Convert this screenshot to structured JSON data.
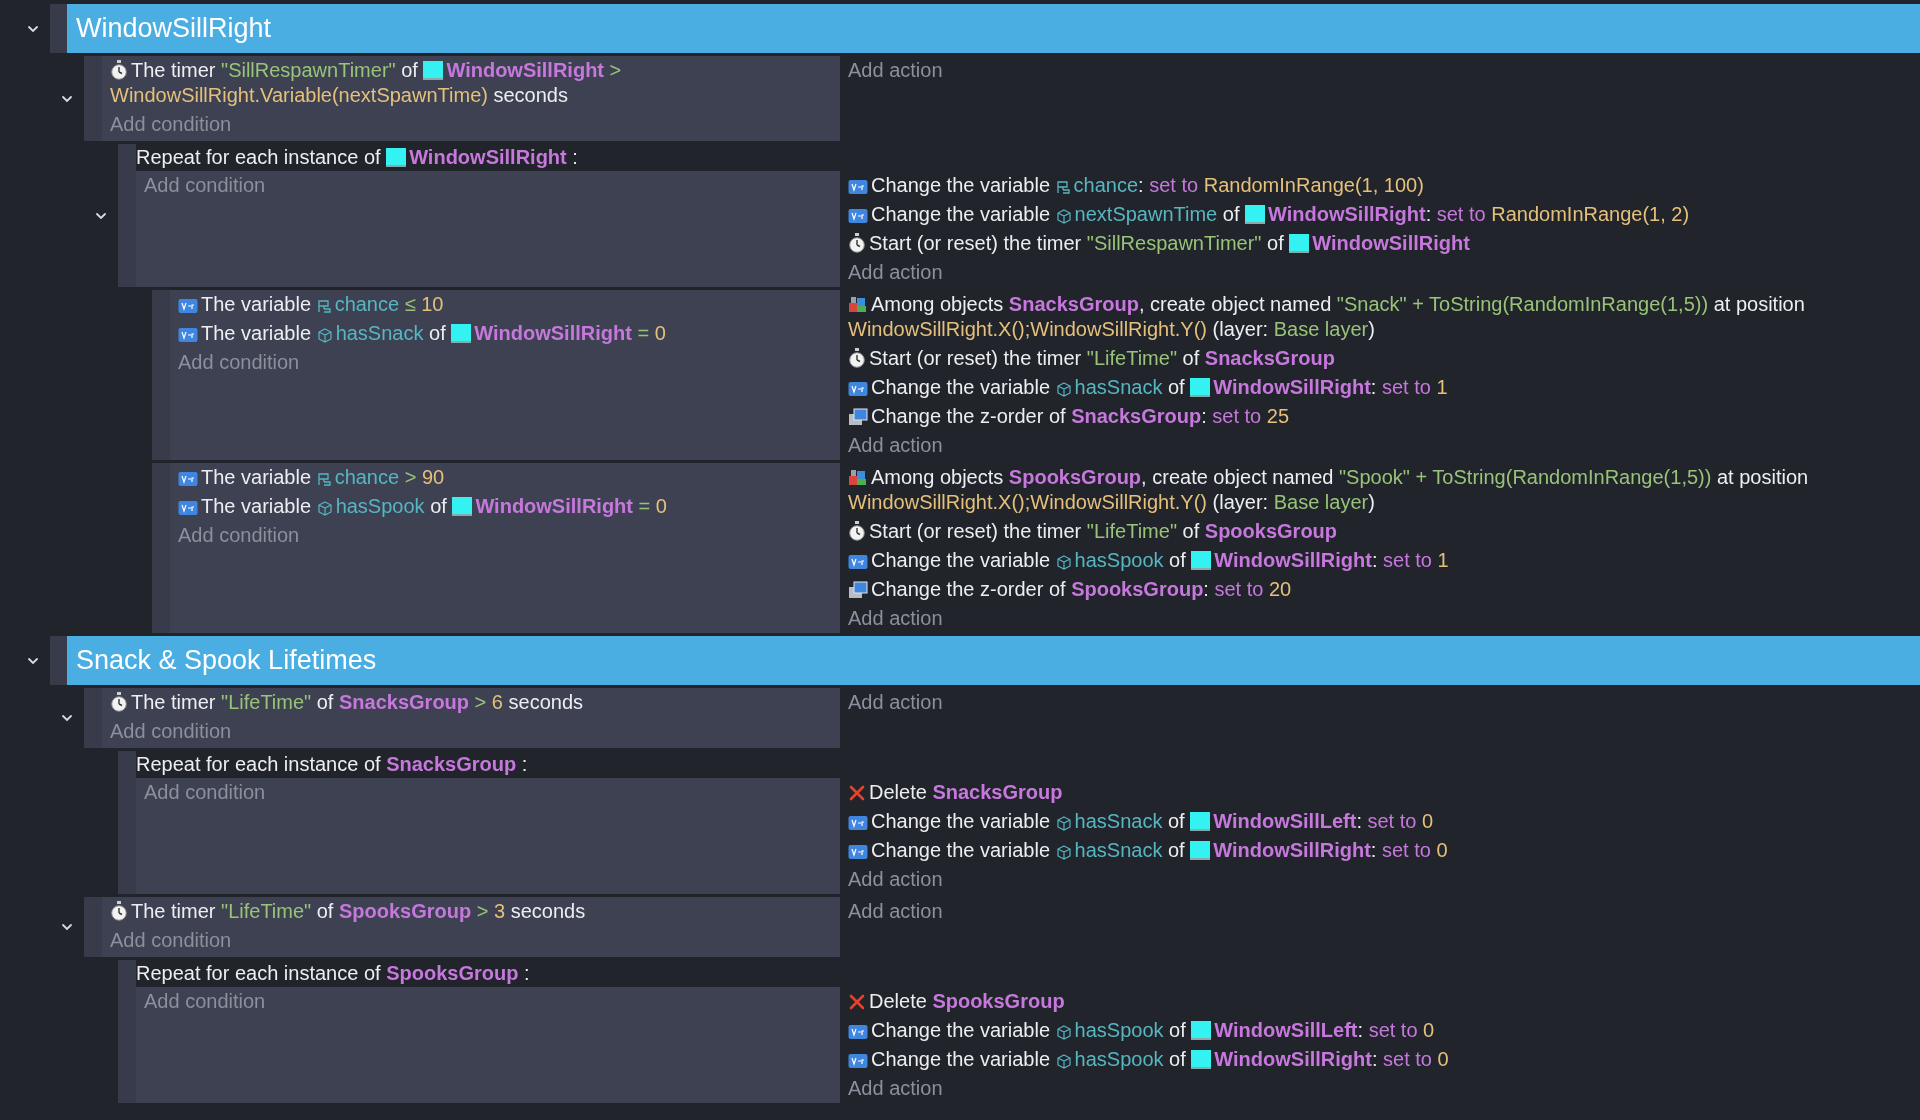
{
  "groups": [
    {
      "title": "WindowSillRight",
      "expanded": true,
      "events": [
        {
          "kind": "standard",
          "expanded": true,
          "conditions": [
            {
              "kind": "timer",
              "segments": [
                {
                  "kind": "text",
                  "text": "The timer"
                },
                {
                  "kind": "string",
                  "text": "\"SillRespawnTimer\""
                },
                {
                  "kind": "text",
                  "text": "of"
                },
                {
                  "kind": "object",
                  "text": "WindowSillRight",
                  "swatch": true
                },
                {
                  "kind": "op",
                  "text": ">"
                },
                {
                  "kind": "expr",
                  "text": "WindowSillRight.Variable(nextSpawnTime)"
                },
                {
                  "kind": "text",
                  "text": "seconds"
                }
              ]
            }
          ],
          "add_condition": "Add condition",
          "add_action": "Add action",
          "children": [
            {
              "kind": "foreach",
              "expanded": true,
              "header": [
                {
                  "kind": "text",
                  "text": "Repeat for each instance of"
                },
                {
                  "kind": "object",
                  "text": "WindowSillRight",
                  "swatch": true
                },
                {
                  "kind": "text",
                  "text": ":"
                }
              ],
              "add_condition": "Add condition",
              "actions": [
                {
                  "kind": "variable",
                  "segments": [
                    {
                      "kind": "text",
                      "text": "Change the variable"
                    },
                    {
                      "kind": "scenevar",
                      "text": "chance"
                    },
                    {
                      "kind": "punct",
                      "text": ":"
                    },
                    {
                      "kind": "keyword",
                      "text": "set to"
                    },
                    {
                      "kind": "expr",
                      "text": "RandomInRange(1, 100)"
                    }
                  ]
                },
                {
                  "kind": "variable",
                  "segments": [
                    {
                      "kind": "text",
                      "text": "Change the variable"
                    },
                    {
                      "kind": "objectvar",
                      "text": "nextSpawnTime"
                    },
                    {
                      "kind": "text",
                      "text": "of"
                    },
                    {
                      "kind": "object",
                      "text": "WindowSillRight",
                      "swatch": true
                    },
                    {
                      "kind": "punct",
                      "text": ":"
                    },
                    {
                      "kind": "keyword",
                      "text": "set to"
                    },
                    {
                      "kind": "expr",
                      "text": "RandomInRange(1, 2)"
                    }
                  ]
                },
                {
                  "kind": "timer",
                  "segments": [
                    {
                      "kind": "text",
                      "text": "Start (or reset) the timer"
                    },
                    {
                      "kind": "string",
                      "text": "\"SillRespawnTimer\""
                    },
                    {
                      "kind": "text",
                      "text": "of"
                    },
                    {
                      "kind": "object",
                      "text": "WindowSillRight",
                      "swatch": true
                    }
                  ]
                }
              ],
              "add_action": "Add action",
              "children": [
                {
                  "kind": "standard",
                  "conditions": [
                    {
                      "kind": "variable",
                      "segments": [
                        {
                          "kind": "text",
                          "text": "The variable"
                        },
                        {
                          "kind": "scenevar",
                          "text": "chance"
                        },
                        {
                          "kind": "op",
                          "text": "≤"
                        },
                        {
                          "kind": "expr",
                          "text": "10"
                        }
                      ]
                    },
                    {
                      "kind": "variable",
                      "segments": [
                        {
                          "kind": "text",
                          "text": "The variable"
                        },
                        {
                          "kind": "objectvar",
                          "text": "hasSnack"
                        },
                        {
                          "kind": "text",
                          "text": "of"
                        },
                        {
                          "kind": "object",
                          "text": "WindowSillRight",
                          "swatch": true
                        },
                        {
                          "kind": "op",
                          "text": "="
                        },
                        {
                          "kind": "expr",
                          "text": "0"
                        }
                      ]
                    }
                  ],
                  "add_condition": "Add condition",
                  "actions": [
                    {
                      "kind": "create",
                      "segments": [
                        {
                          "kind": "text",
                          "text": "Among objects"
                        },
                        {
                          "kind": "object",
                          "text": "SnacksGroup",
                          "swatch": false
                        },
                        {
                          "kind": "punct",
                          "text": ","
                        },
                        {
                          "kind": "text",
                          "text": "create object named"
                        },
                        {
                          "kind": "string",
                          "text": "\"Snack\" + ToString(RandomInRange(1,5))"
                        },
                        {
                          "kind": "text",
                          "text": "at"
                        },
                        {
                          "kind": "text",
                          "text": "position"
                        },
                        {
                          "kind": "expr",
                          "text": "WindowSillRight.X();WindowSillRight.Y()"
                        },
                        {
                          "kind": "text",
                          "text": "(layer:"
                        },
                        {
                          "kind": "string",
                          "text": "Base layer"
                        },
                        {
                          "kind": "punct",
                          "text": ")"
                        }
                      ]
                    },
                    {
                      "kind": "timer",
                      "segments": [
                        {
                          "kind": "text",
                          "text": "Start (or reset) the timer"
                        },
                        {
                          "kind": "string",
                          "text": "\"LifeTime\""
                        },
                        {
                          "kind": "text",
                          "text": "of"
                        },
                        {
                          "kind": "object",
                          "text": "SnacksGroup",
                          "swatch": false
                        }
                      ]
                    },
                    {
                      "kind": "variable",
                      "segments": [
                        {
                          "kind": "text",
                          "text": "Change the variable"
                        },
                        {
                          "kind": "objectvar",
                          "text": "hasSnack"
                        },
                        {
                          "kind": "text",
                          "text": "of"
                        },
                        {
                          "kind": "object",
                          "text": "WindowSillRight",
                          "swatch": true
                        },
                        {
                          "kind": "punct",
                          "text": ":"
                        },
                        {
                          "kind": "keyword",
                          "text": "set to"
                        },
                        {
                          "kind": "expr",
                          "text": "1"
                        }
                      ]
                    },
                    {
                      "kind": "zorder",
                      "segments": [
                        {
                          "kind": "text",
                          "text": "Change the z-order of"
                        },
                        {
                          "kind": "object",
                          "text": "SnacksGroup",
                          "swatch": false
                        },
                        {
                          "kind": "punct",
                          "text": ":"
                        },
                        {
                          "kind": "keyword",
                          "text": "set to"
                        },
                        {
                          "kind": "expr",
                          "text": "25"
                        }
                      ]
                    }
                  ],
                  "add_action": "Add action"
                },
                {
                  "kind": "standard",
                  "conditions": [
                    {
                      "kind": "variable",
                      "segments": [
                        {
                          "kind": "text",
                          "text": "The variable"
                        },
                        {
                          "kind": "scenevar",
                          "text": "chance"
                        },
                        {
                          "kind": "op",
                          "text": ">"
                        },
                        {
                          "kind": "expr",
                          "text": "90"
                        }
                      ]
                    },
                    {
                      "kind": "variable",
                      "segments": [
                        {
                          "kind": "text",
                          "text": "The variable"
                        },
                        {
                          "kind": "objectvar",
                          "text": "hasSpook"
                        },
                        {
                          "kind": "text",
                          "text": "of"
                        },
                        {
                          "kind": "object",
                          "text": "WindowSillRight",
                          "swatch": true
                        },
                        {
                          "kind": "op",
                          "text": "="
                        },
                        {
                          "kind": "expr",
                          "text": "0"
                        }
                      ]
                    }
                  ],
                  "add_condition": "Add condition",
                  "actions": [
                    {
                      "kind": "create",
                      "segments": [
                        {
                          "kind": "text",
                          "text": "Among objects"
                        },
                        {
                          "kind": "object",
                          "text": "SpooksGroup",
                          "swatch": false
                        },
                        {
                          "kind": "punct",
                          "text": ","
                        },
                        {
                          "kind": "text",
                          "text": "create object named"
                        },
                        {
                          "kind": "string",
                          "text": "\"Spook\" + ToString(RandomInRange(1,5))"
                        },
                        {
                          "kind": "text",
                          "text": "at"
                        },
                        {
                          "kind": "text",
                          "text": "position"
                        },
                        {
                          "kind": "expr",
                          "text": "WindowSillRight.X();WindowSillRight.Y()"
                        },
                        {
                          "kind": "text",
                          "text": "(layer:"
                        },
                        {
                          "kind": "string",
                          "text": "Base layer"
                        },
                        {
                          "kind": "punct",
                          "text": ")"
                        }
                      ]
                    },
                    {
                      "kind": "timer",
                      "segments": [
                        {
                          "kind": "text",
                          "text": "Start (or reset) the timer"
                        },
                        {
                          "kind": "string",
                          "text": "\"LifeTime\""
                        },
                        {
                          "kind": "text",
                          "text": "of"
                        },
                        {
                          "kind": "object",
                          "text": "SpooksGroup",
                          "swatch": false
                        }
                      ]
                    },
                    {
                      "kind": "variable",
                      "segments": [
                        {
                          "kind": "text",
                          "text": "Change the variable"
                        },
                        {
                          "kind": "objectvar",
                          "text": "hasSpook"
                        },
                        {
                          "kind": "text",
                          "text": "of"
                        },
                        {
                          "kind": "object",
                          "text": "WindowSillRight",
                          "swatch": true
                        },
                        {
                          "kind": "punct",
                          "text": ":"
                        },
                        {
                          "kind": "keyword",
                          "text": "set to"
                        },
                        {
                          "kind": "expr",
                          "text": "1"
                        }
                      ]
                    },
                    {
                      "kind": "zorder",
                      "segments": [
                        {
                          "kind": "text",
                          "text": "Change the z-order of"
                        },
                        {
                          "kind": "object",
                          "text": "SpooksGroup",
                          "swatch": false
                        },
                        {
                          "kind": "punct",
                          "text": ":"
                        },
                        {
                          "kind": "keyword",
                          "text": "set to"
                        },
                        {
                          "kind": "expr",
                          "text": "20"
                        }
                      ]
                    }
                  ],
                  "add_action": "Add action"
                }
              ]
            }
          ]
        }
      ]
    },
    {
      "title": "Snack & Spook Lifetimes",
      "expanded": true,
      "events": [
        {
          "kind": "standard",
          "expanded": true,
          "conditions": [
            {
              "kind": "timer",
              "segments": [
                {
                  "kind": "text",
                  "text": "The timer"
                },
                {
                  "kind": "string",
                  "text": "\"LifeTime\""
                },
                {
                  "kind": "text",
                  "text": "of"
                },
                {
                  "kind": "object",
                  "text": "SnacksGroup",
                  "swatch": false
                },
                {
                  "kind": "op",
                  "text": ">"
                },
                {
                  "kind": "expr",
                  "text": "6"
                },
                {
                  "kind": "text",
                  "text": "seconds"
                }
              ]
            }
          ],
          "add_condition": "Add condition",
          "add_action": "Add action",
          "children": [
            {
              "kind": "foreach",
              "header": [
                {
                  "kind": "text",
                  "text": "Repeat for each instance of"
                },
                {
                  "kind": "object",
                  "text": "SnacksGroup",
                  "swatch": false
                },
                {
                  "kind": "text",
                  "text": ":"
                }
              ],
              "add_condition": "Add condition",
              "actions": [
                {
                  "kind": "delete",
                  "segments": [
                    {
                      "kind": "text",
                      "text": "Delete"
                    },
                    {
                      "kind": "object",
                      "text": "SnacksGroup",
                      "swatch": false
                    }
                  ]
                },
                {
                  "kind": "variable",
                  "segments": [
                    {
                      "kind": "text",
                      "text": "Change the variable"
                    },
                    {
                      "kind": "objectvar",
                      "text": "hasSnack"
                    },
                    {
                      "kind": "text",
                      "text": "of"
                    },
                    {
                      "kind": "object",
                      "text": "WindowSillLeft",
                      "swatch": true
                    },
                    {
                      "kind": "punct",
                      "text": ":"
                    },
                    {
                      "kind": "keyword",
                      "text": "set to"
                    },
                    {
                      "kind": "expr",
                      "text": "0"
                    }
                  ]
                },
                {
                  "kind": "variable",
                  "segments": [
                    {
                      "kind": "text",
                      "text": "Change the variable"
                    },
                    {
                      "kind": "objectvar",
                      "text": "hasSnack"
                    },
                    {
                      "kind": "text",
                      "text": "of"
                    },
                    {
                      "kind": "object",
                      "text": "WindowSillRight",
                      "swatch": true
                    },
                    {
                      "kind": "punct",
                      "text": ":"
                    },
                    {
                      "kind": "keyword",
                      "text": "set to"
                    },
                    {
                      "kind": "expr",
                      "text": "0"
                    }
                  ]
                }
              ],
              "add_action": "Add action"
            }
          ]
        },
        {
          "kind": "standard",
          "expanded": true,
          "conditions": [
            {
              "kind": "timer",
              "segments": [
                {
                  "kind": "text",
                  "text": "The timer"
                },
                {
                  "kind": "string",
                  "text": "\"LifeTime\""
                },
                {
                  "kind": "text",
                  "text": "of"
                },
                {
                  "kind": "object",
                  "text": "SpooksGroup",
                  "swatch": false
                },
                {
                  "kind": "op",
                  "text": ">"
                },
                {
                  "kind": "expr",
                  "text": "3"
                },
                {
                  "kind": "text",
                  "text": "seconds"
                }
              ]
            }
          ],
          "add_condition": "Add condition",
          "add_action": "Add action",
          "children": [
            {
              "kind": "foreach",
              "header": [
                {
                  "kind": "text",
                  "text": "Repeat for each instance of"
                },
                {
                  "kind": "object",
                  "text": "SpooksGroup",
                  "swatch": false
                },
                {
                  "kind": "text",
                  "text": ":"
                }
              ],
              "add_condition": "Add condition",
              "actions": [
                {
                  "kind": "delete",
                  "segments": [
                    {
                      "kind": "text",
                      "text": "Delete"
                    },
                    {
                      "kind": "object",
                      "text": "SpooksGroup",
                      "swatch": false
                    }
                  ]
                },
                {
                  "kind": "variable",
                  "segments": [
                    {
                      "kind": "text",
                      "text": "Change the variable"
                    },
                    {
                      "kind": "objectvar",
                      "text": "hasSpook"
                    },
                    {
                      "kind": "text",
                      "text": "of"
                    },
                    {
                      "kind": "object",
                      "text": "WindowSillLeft",
                      "swatch": true
                    },
                    {
                      "kind": "punct",
                      "text": ":"
                    },
                    {
                      "kind": "keyword",
                      "text": "set to"
                    },
                    {
                      "kind": "expr",
                      "text": "0"
                    }
                  ]
                },
                {
                  "kind": "variable",
                  "segments": [
                    {
                      "kind": "text",
                      "text": "Change the variable"
                    },
                    {
                      "kind": "objectvar",
                      "text": "hasSpook"
                    },
                    {
                      "kind": "text",
                      "text": "of"
                    },
                    {
                      "kind": "object",
                      "text": "WindowSillRight",
                      "swatch": true
                    },
                    {
                      "kind": "punct",
                      "text": ":"
                    },
                    {
                      "kind": "keyword",
                      "text": "set to"
                    },
                    {
                      "kind": "expr",
                      "text": "0"
                    }
                  ]
                }
              ],
              "add_action": "Add action"
            }
          ]
        }
      ]
    }
  ]
}
